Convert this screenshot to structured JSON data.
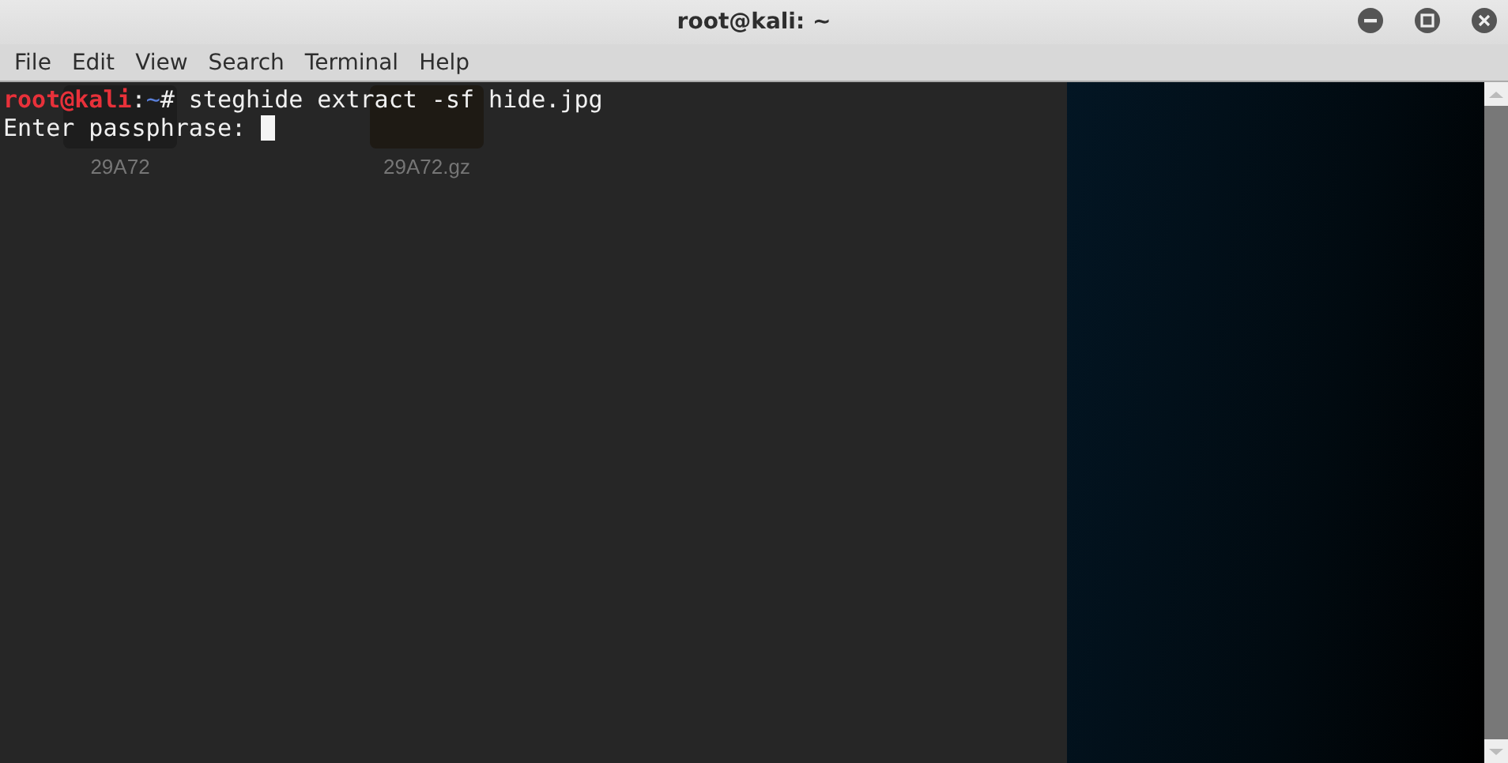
{
  "window": {
    "title": "root@kali: ~"
  },
  "menu": [
    "File",
    "Edit",
    "View",
    "Search",
    "Terminal",
    "Help"
  ],
  "desktop_icons": [
    {
      "label": "29A72"
    },
    {
      "label": "29A72.gz"
    }
  ],
  "terminal": {
    "prompt": {
      "user": "root@kali",
      "separator": ":",
      "path": "~",
      "symbol": "#"
    },
    "command": " steghide extract -sf hide.jpg",
    "output": "Enter passphrase: ",
    "cursor": true
  }
}
